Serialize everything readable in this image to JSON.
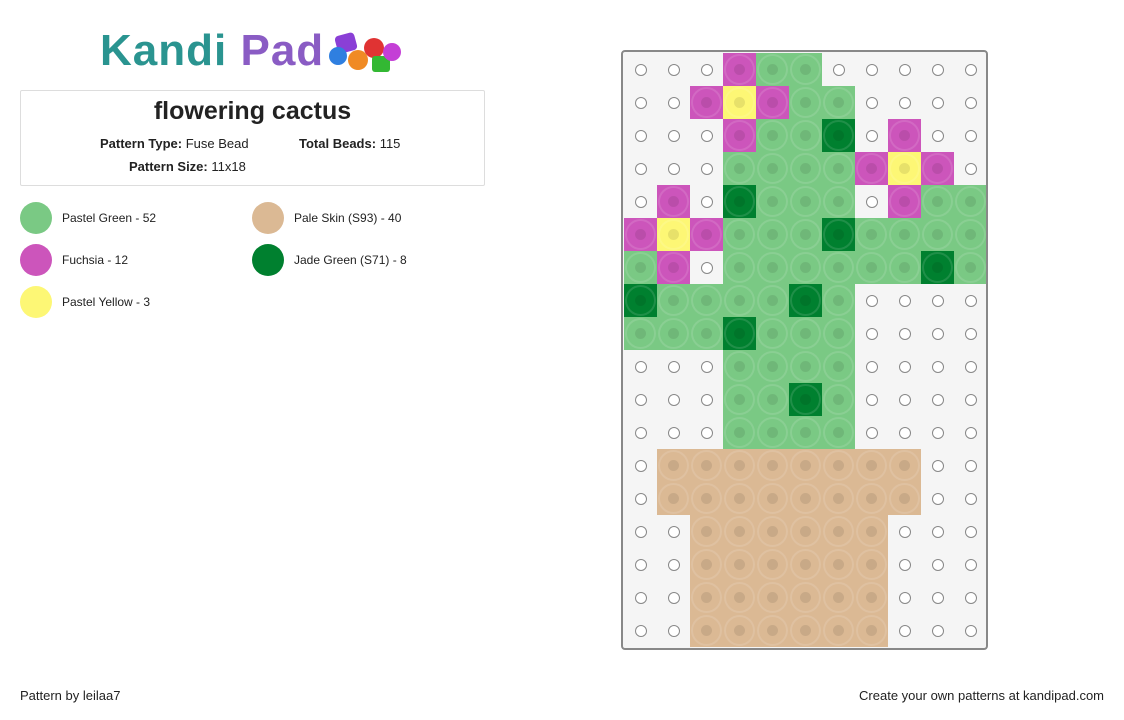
{
  "logo": {
    "part1": "Kandi",
    "part2": "Pad"
  },
  "pattern": {
    "title": "flowering cactus",
    "type_label": "Pattern Type:",
    "type_value": "Fuse Bead",
    "beads_label": "Total Beads:",
    "beads_value": "115",
    "size_label": "Pattern Size:",
    "size_value": "11x18"
  },
  "legend": [
    {
      "code": "G",
      "label": "Pastel Green - 52",
      "color": "#7ac984"
    },
    {
      "code": "S",
      "label": "Pale Skin (S93) - 40",
      "color": "#dbb994"
    },
    {
      "code": "F",
      "label": "Fuchsia - 12",
      "color": "#cc55bb"
    },
    {
      "code": "J",
      "label": "Jade Green (S71) - 8",
      "color": "#00802f"
    },
    {
      "code": "Y",
      "label": "Pastel Yellow - 3",
      "color": "#fdf775"
    }
  ],
  "grid": [
    "...FGG.....",
    "..FYFGG....",
    "...FGGJ.F..",
    "...GGGGFYF.",
    ".F.JGGG.FGG",
    "FYFGGGJGGGG",
    "GF.GGGGGGJG",
    "JGGGGJG....",
    "GGGJGGG....",
    "...GGGG....",
    "...GGJG....",
    "...GGGG....",
    ".SSSSSSSS..",
    ".SSSSSSSS..",
    "..SSSSSS...",
    "..SSSSSS...",
    "..SSSSSS...",
    "..SSSSSS..."
  ],
  "footer": {
    "left": "Pattern by leilaa7",
    "right": "Create your own patterns at kandipad.com"
  }
}
